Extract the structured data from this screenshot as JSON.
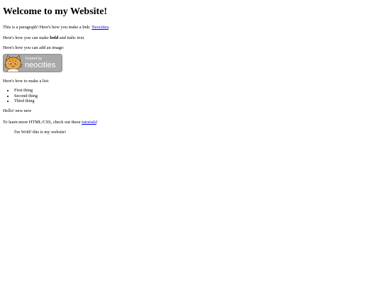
{
  "heading": "Welcome to my Website!",
  "intro": {
    "before": "This is a paragraph! Here's how you make a link: ",
    "link": "Neocities",
    "after": "."
  },
  "format": {
    "before": "Here's how you can make ",
    "bold": "bold",
    "middle": " and ",
    "italic": "italic",
    "after": " text."
  },
  "image_line": "Here's how you can add an image:",
  "badge": {
    "small": "hosted by",
    "big": "neocities"
  },
  "list_line": "Here's how to make a list:",
  "list_items": [
    "First thing",
    "Second thing",
    "Third thing"
  ],
  "hello": "Hello! new new",
  "learn": {
    "before": "To learn more HTML/CSS, check out these ",
    "link": "tutorials",
    "after": "!"
  },
  "footer": "I'm Wrld! this is my website!",
  "colors": {
    "link": "#0000ee",
    "badge_bg": "#a9a9a9",
    "cat_orange": "#f3a53a"
  }
}
